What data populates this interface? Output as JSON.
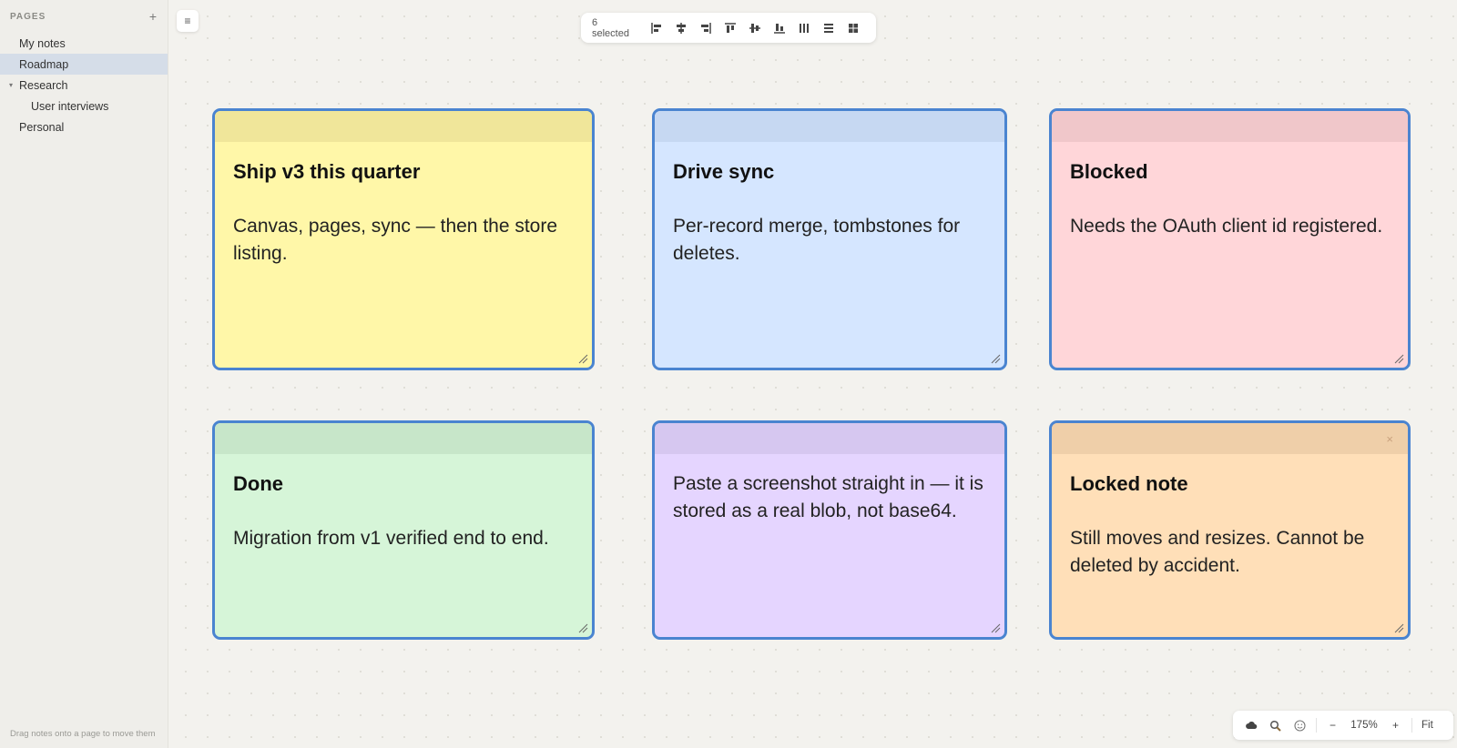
{
  "sidebar": {
    "title": "PAGES",
    "add_label": "+",
    "items": [
      {
        "label": "My notes",
        "level": 0,
        "active": false
      },
      {
        "label": "Roadmap",
        "level": 0,
        "active": true
      },
      {
        "label": "Research",
        "level": 0,
        "active": false,
        "expanded": true
      },
      {
        "label": "User interviews",
        "level": 1,
        "active": false
      },
      {
        "label": "Personal",
        "level": 0,
        "active": false
      }
    ],
    "footer_hint": "Drag notes onto a page to move them"
  },
  "canvas": {
    "menu_icon": "≡"
  },
  "toolbar": {
    "selected_label": "6 selected",
    "buttons": [
      {
        "name": "align-left-icon"
      },
      {
        "name": "align-center-horizontal-icon"
      },
      {
        "name": "align-right-icon"
      },
      {
        "name": "align-top-icon"
      },
      {
        "name": "align-middle-vertical-icon"
      },
      {
        "name": "align-bottom-icon"
      },
      {
        "name": "distribute-horizontal-icon"
      },
      {
        "name": "distribute-vertical-icon"
      },
      {
        "name": "grid-arrange-icon"
      }
    ]
  },
  "notes": [
    {
      "heading": "Ship v3 this quarter",
      "text": "Canvas, pages, sync — then the store listing.",
      "color": "#fff7a8",
      "strip": "#f0e69a",
      "locked": false
    },
    {
      "heading": "Drive sync",
      "text": "Per-record merge, tombstones for deletes.",
      "color": "#d5e6ff",
      "strip": "#c6d8f2",
      "locked": false
    },
    {
      "heading": "Blocked",
      "text": "Needs the OAuth client id registered.",
      "color": "#ffd6d9",
      "strip": "#f0c7ca",
      "locked": false
    },
    {
      "heading": "Done",
      "text": "Migration from v1 verified end to end.",
      "color": "#d6f5d8",
      "strip": "#c7e6c9",
      "locked": false
    },
    {
      "heading": "",
      "text": "Paste a screenshot straight in — it is stored as a real blob, not base64.",
      "color": "#e5d5ff",
      "strip": "#d6c7f0",
      "locked": false
    },
    {
      "heading": "Locked note",
      "text": "Still moves and resizes. Cannot be deleted by accident.",
      "color": "#ffdfb8",
      "strip": "#efcfa9",
      "locked": true,
      "close_label": "×"
    }
  ],
  "zoom": {
    "cloud_icon": "cloud-icon",
    "search_icon": "search-icon",
    "emoji_icon": "emoji-icon",
    "minus_label": "−",
    "level": "175%",
    "plus_label": "+",
    "fit_label": "Fit"
  },
  "colors": {
    "selection": "#4a84d0",
    "sidebar_active": "#d5dde8"
  }
}
